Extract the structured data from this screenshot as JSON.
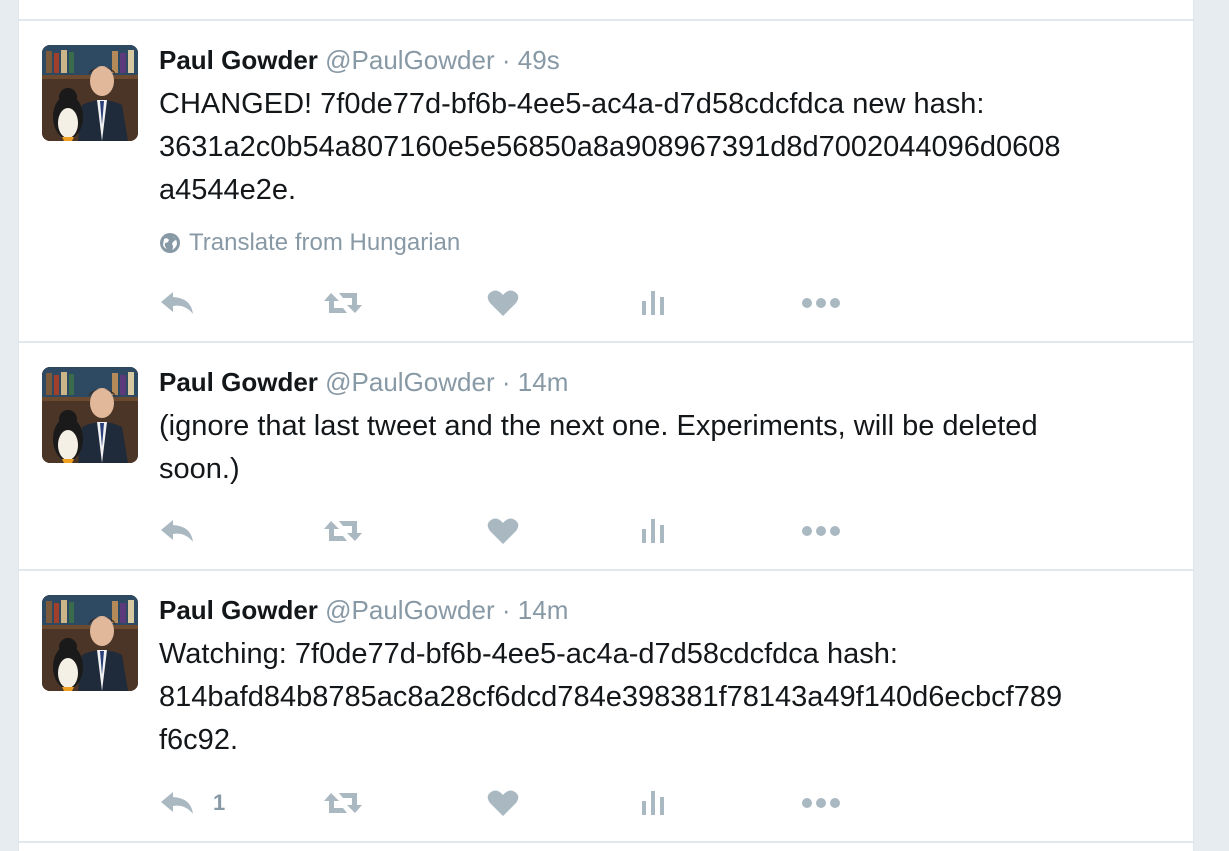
{
  "tweets": [
    {
      "fullname": "Paul Gowder",
      "username": "@PaulGowder",
      "separator": "·",
      "time": "49s",
      "text": "CHANGED! 7f0de77d-bf6b-4ee5-ac4a-d7d58cdcfdca new hash:\n3631a2c0b54a807160e5e56850a8a908967391d8d7002044096d0608\na4544e2e.",
      "translate_label": "Translate from Hungarian",
      "reply_count": ""
    },
    {
      "fullname": "Paul Gowder",
      "username": "@PaulGowder",
      "separator": "·",
      "time": "14m",
      "text": "(ignore that last tweet and the next one.  Experiments, will be deleted\nsoon.)",
      "translate_label": "",
      "reply_count": ""
    },
    {
      "fullname": "Paul Gowder",
      "username": "@PaulGowder",
      "separator": "·",
      "time": "14m",
      "text": "Watching: 7f0de77d-bf6b-4ee5-ac4a-d7d58cdcfdca hash:\n814bafd84b8785ac8a28cf6dcd784e398381f78143a49f140d6ecbcf789\nf6c92.",
      "translate_label": "",
      "reply_count": "1"
    }
  ],
  "icons": {
    "reply": "reply-icon",
    "retweet": "retweet-icon",
    "like": "heart-icon",
    "analytics": "analytics-icon",
    "more": "more-icon",
    "globe": "globe-icon"
  },
  "colors": {
    "action_gray": "#aab8c2",
    "meta_gray": "#8899a6",
    "text": "#14171a",
    "border": "#e1e8ed"
  }
}
